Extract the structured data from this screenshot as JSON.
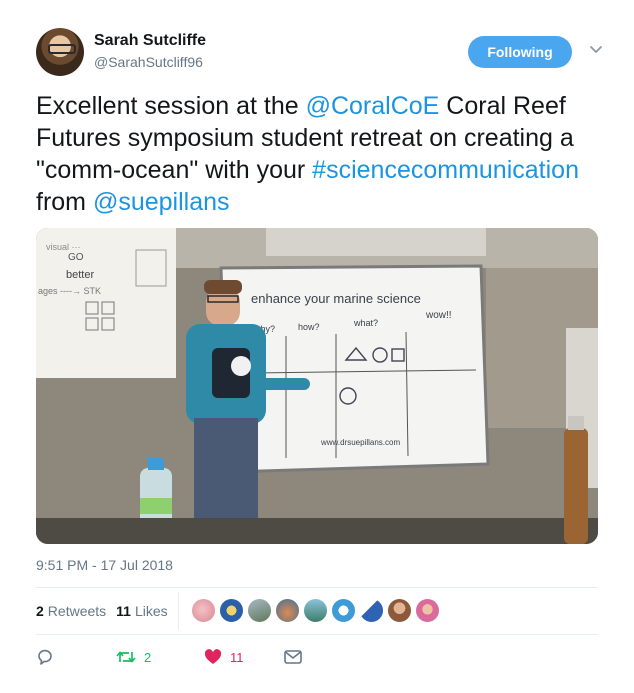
{
  "user": {
    "name": "Sarah Sutcliffe",
    "handle": "@SarahSutcliff96",
    "follow_label": "Following"
  },
  "tweet": {
    "segments": [
      {
        "text": "Excellent session at the ",
        "link": false
      },
      {
        "text": "@CoralCoE",
        "link": true
      },
      {
        "text": " Coral Reef Futures symposium student retreat on creating a \"comm-ocean\" with your ",
        "link": false
      },
      {
        "text": "#sciencecommunication",
        "link": true
      },
      {
        "text": " from ",
        "link": false
      },
      {
        "text": "@suepillans",
        "link": true
      }
    ]
  },
  "photo": {
    "whiteboard_text": {
      "title": "enhance your marine science",
      "url": "www.drsuepillans.com",
      "wow": "wow!!",
      "what": "what?",
      "how": "how?",
      "why": "why?",
      "left_board_better": "better"
    }
  },
  "timestamp": "9:51 PM - 17 Jul 2018",
  "stats": {
    "retweets_count": "2",
    "retweets_label": "Retweets",
    "likes_count": "11",
    "likes_label": "Likes"
  },
  "actions": {
    "retweet_count": "2",
    "like_count": "11"
  },
  "colors": {
    "accent": "#1b95e0",
    "follow_button": "#4aa6ee",
    "retweet": "#17bf63",
    "like": "#e0245e"
  },
  "icons": [
    "reply-icon",
    "retweet-icon",
    "heart-icon",
    "message-icon",
    "chevron-down-icon"
  ]
}
